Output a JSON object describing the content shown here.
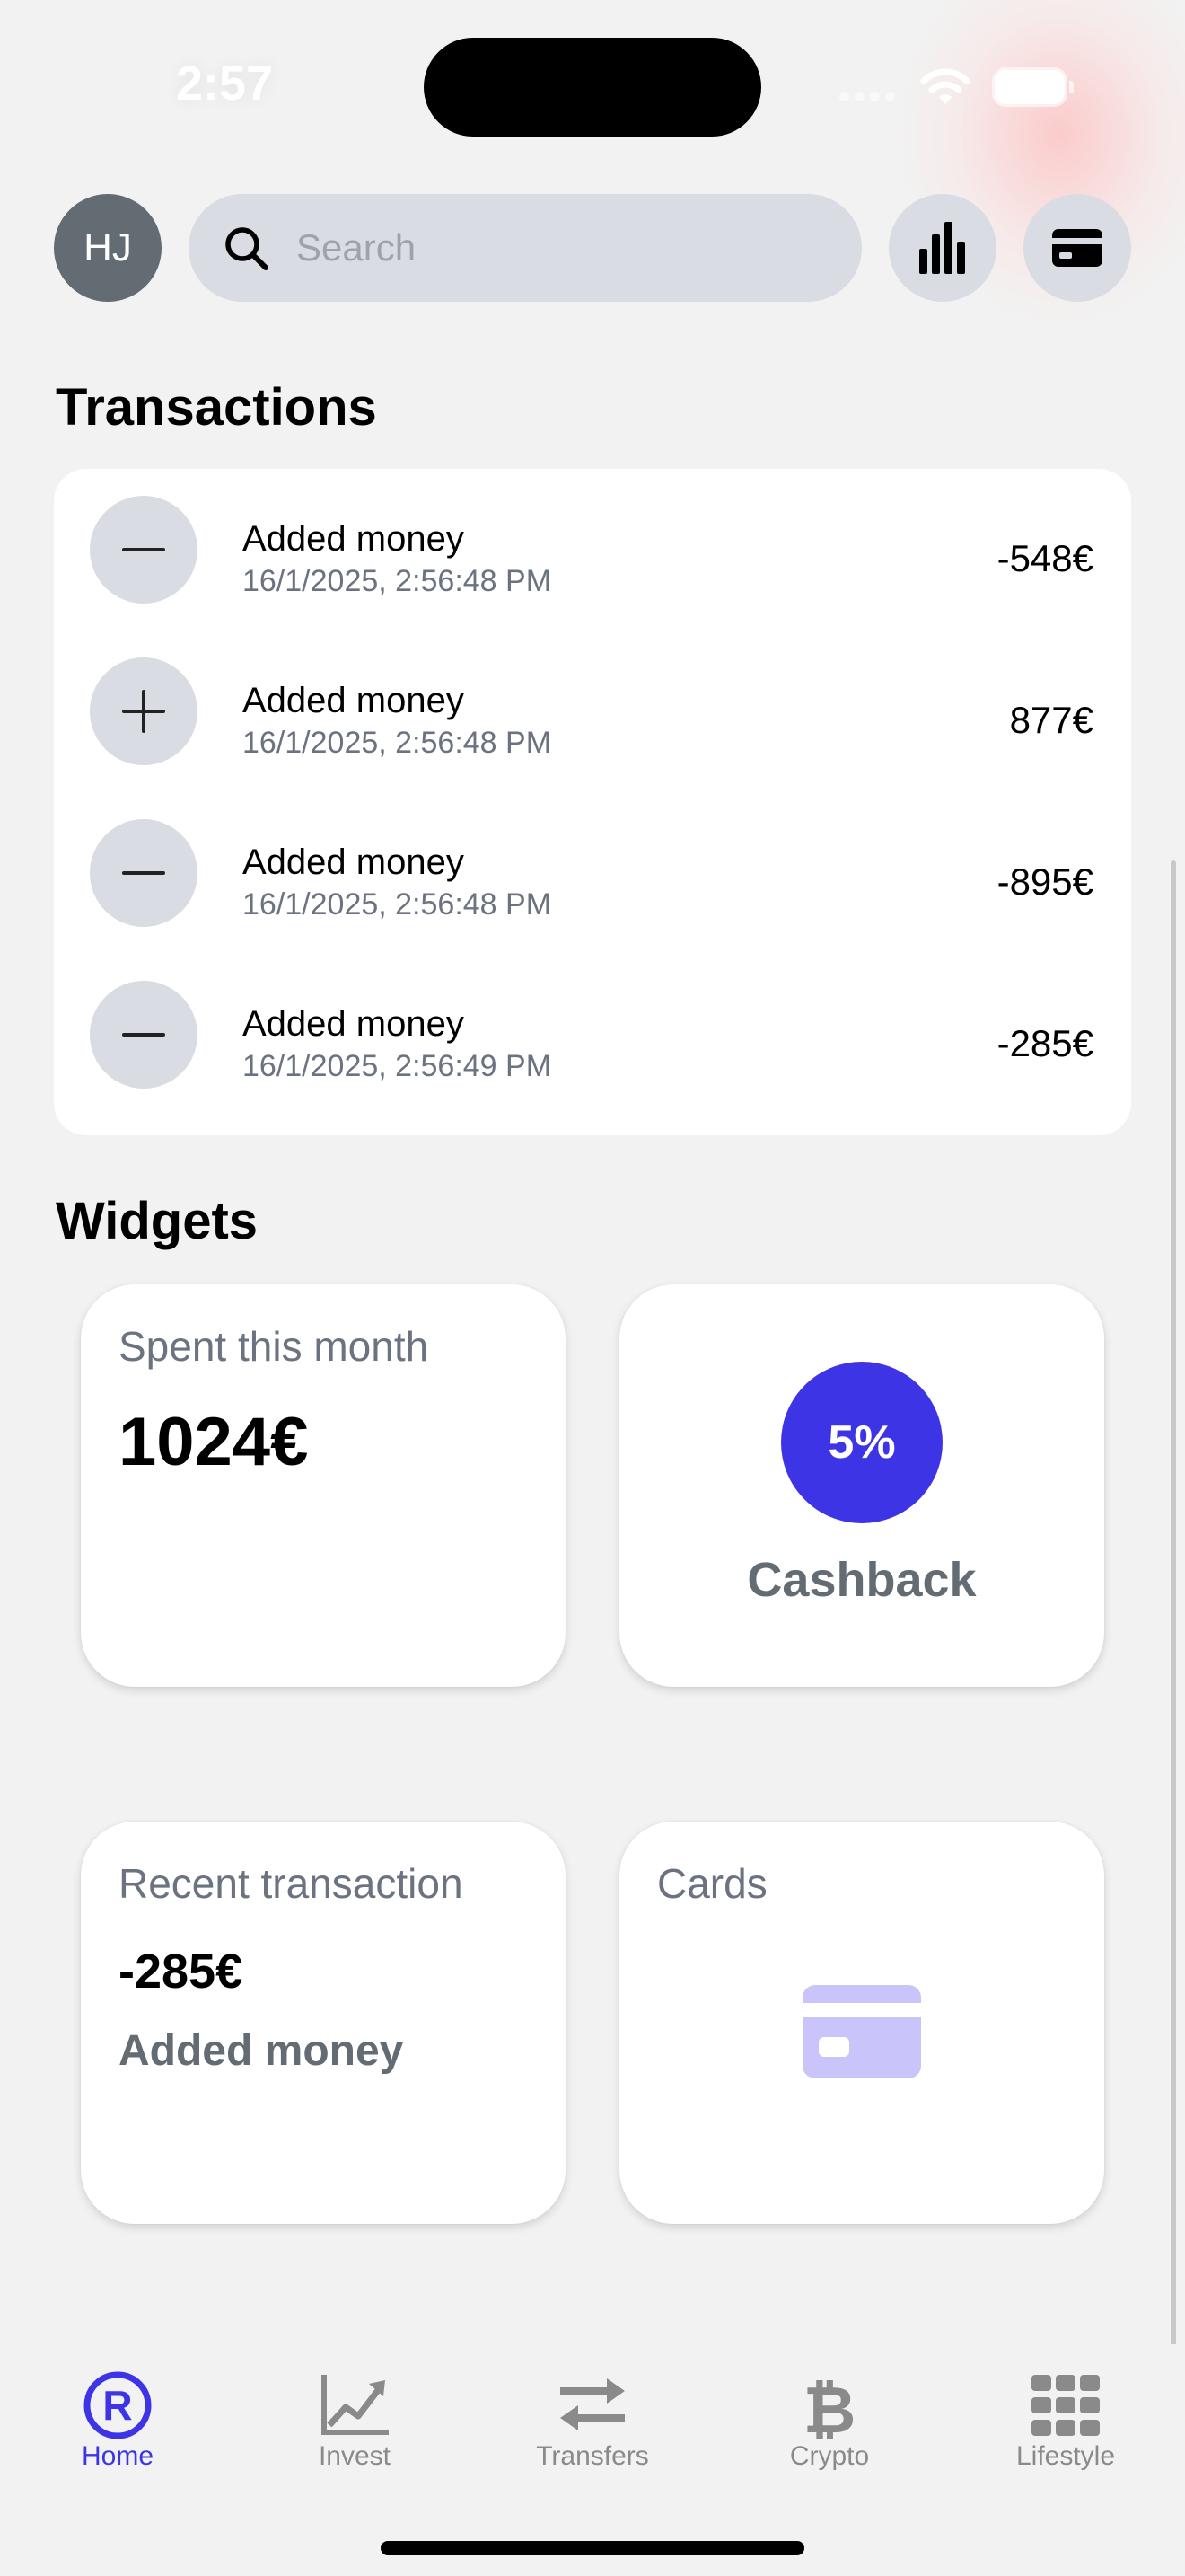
{
  "status_bar": {
    "time": "2:57"
  },
  "header": {
    "avatar_initials": "HJ",
    "search_placeholder": "Search",
    "stats_icon": "bar-chart-icon",
    "card_icon": "credit-card-icon"
  },
  "transactions": {
    "title": "Transactions",
    "items": [
      {
        "sign_icon": "minus-icon",
        "title": "Added money",
        "date": "16/1/2025, 2:56:48 PM",
        "amount": "-548€"
      },
      {
        "sign_icon": "plus-icon",
        "title": "Added money",
        "date": "16/1/2025, 2:56:48 PM",
        "amount": "877€"
      },
      {
        "sign_icon": "minus-icon",
        "title": "Added money",
        "date": "16/1/2025, 2:56:48 PM",
        "amount": "-895€"
      },
      {
        "sign_icon": "minus-icon",
        "title": "Added money",
        "date": "16/1/2025, 2:56:49 PM",
        "amount": "-285€"
      }
    ]
  },
  "widgets": {
    "title": "Widgets",
    "spent": {
      "label": "Spent this month",
      "value": "1024€"
    },
    "cashback": {
      "percent": "5%",
      "label": "Cashback"
    },
    "recent": {
      "label": "Recent transaction",
      "amount": "-285€",
      "description": "Added money"
    },
    "cards": {
      "label": "Cards",
      "icon": "credit-card-icon"
    }
  },
  "tab_bar": {
    "tabs": [
      {
        "label": "Home",
        "icon": "revolut-r-icon",
        "active": true
      },
      {
        "label": "Invest",
        "icon": "line-chart-icon",
        "active": false
      },
      {
        "label": "Transfers",
        "icon": "transfer-arrows-icon",
        "active": false
      },
      {
        "label": "Crypto",
        "icon": "bitcoin-icon",
        "active": false
      },
      {
        "label": "Lifestyle",
        "icon": "grid-icon",
        "active": false
      }
    ]
  },
  "colors": {
    "accent": "#3d34e6",
    "background": "#f2f2f2",
    "control_gray": "#d9dce2",
    "text_secondary": "#6b7280",
    "avatar_gray": "#636b73",
    "card_icon_lavender": "#c9c5fb"
  }
}
